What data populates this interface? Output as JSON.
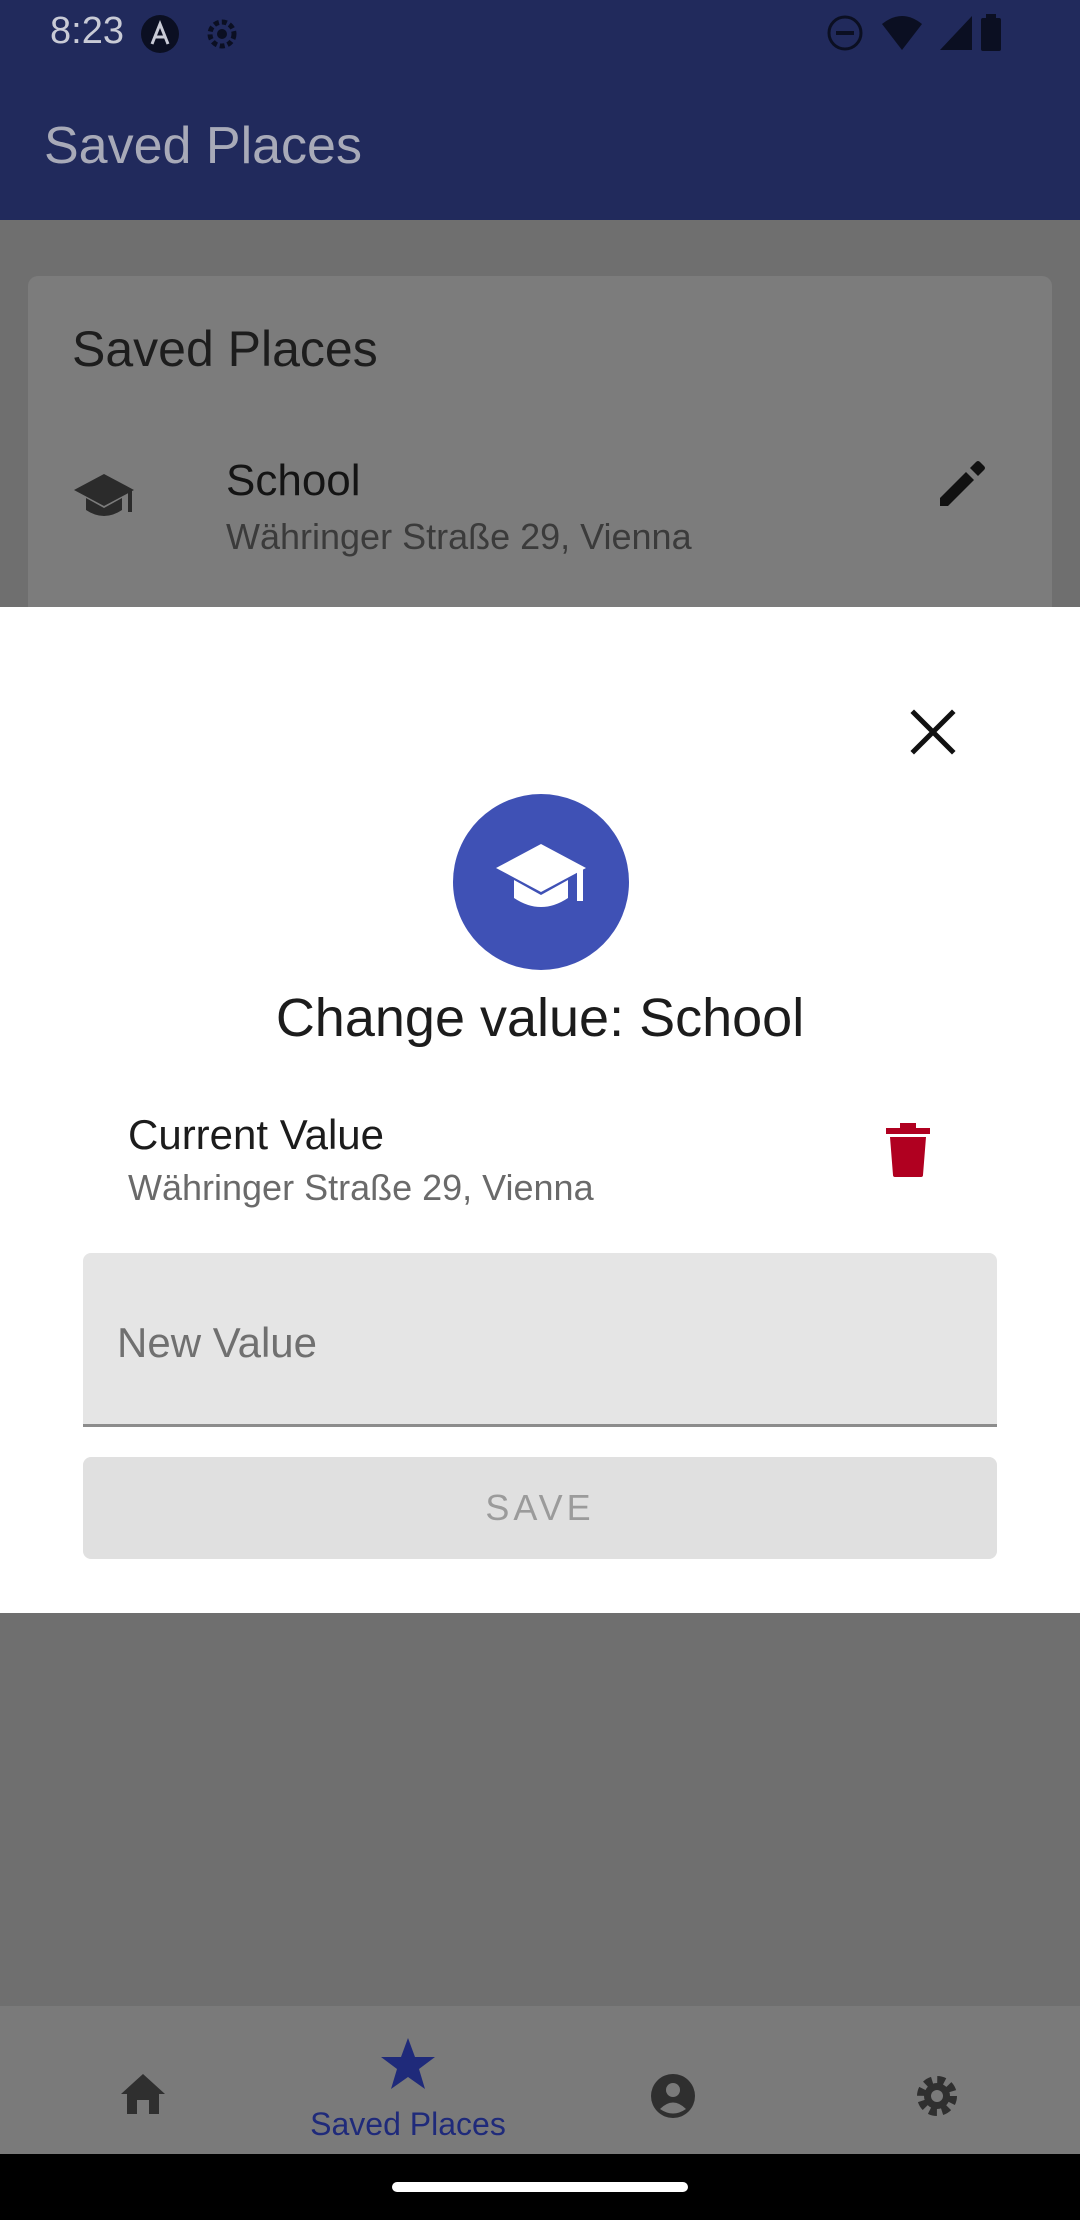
{
  "status": {
    "time": "8:23",
    "left_icons": [
      "app-a-icon",
      "gear-icon"
    ],
    "right_icons": [
      "do-not-disturb-icon",
      "wifi-icon",
      "signal-icon",
      "battery-icon"
    ]
  },
  "appbar": {
    "title": "Saved Places"
  },
  "card": {
    "title": "Saved Places",
    "place": {
      "icon": "school-icon",
      "name": "School",
      "address": "Währinger Straße 29, Vienna"
    }
  },
  "sheet": {
    "title": "Change value: School",
    "current_label": "Current Value",
    "current_value": "Währinger Straße 29, Vienna",
    "new_value_placeholder": "New Value",
    "save_label": "SAVE"
  },
  "nav": {
    "items": [
      {
        "icon": "home-icon",
        "label": ""
      },
      {
        "icon": "star-icon",
        "label": "Saved Places",
        "active": true
      },
      {
        "icon": "account-icon",
        "label": ""
      },
      {
        "icon": "settings-icon",
        "label": ""
      }
    ]
  },
  "colors": {
    "primary": "#3f51b5",
    "appbar_dimmed": "#212a5c",
    "delete": "#b00020",
    "nav_active": "#1f2a7a"
  }
}
